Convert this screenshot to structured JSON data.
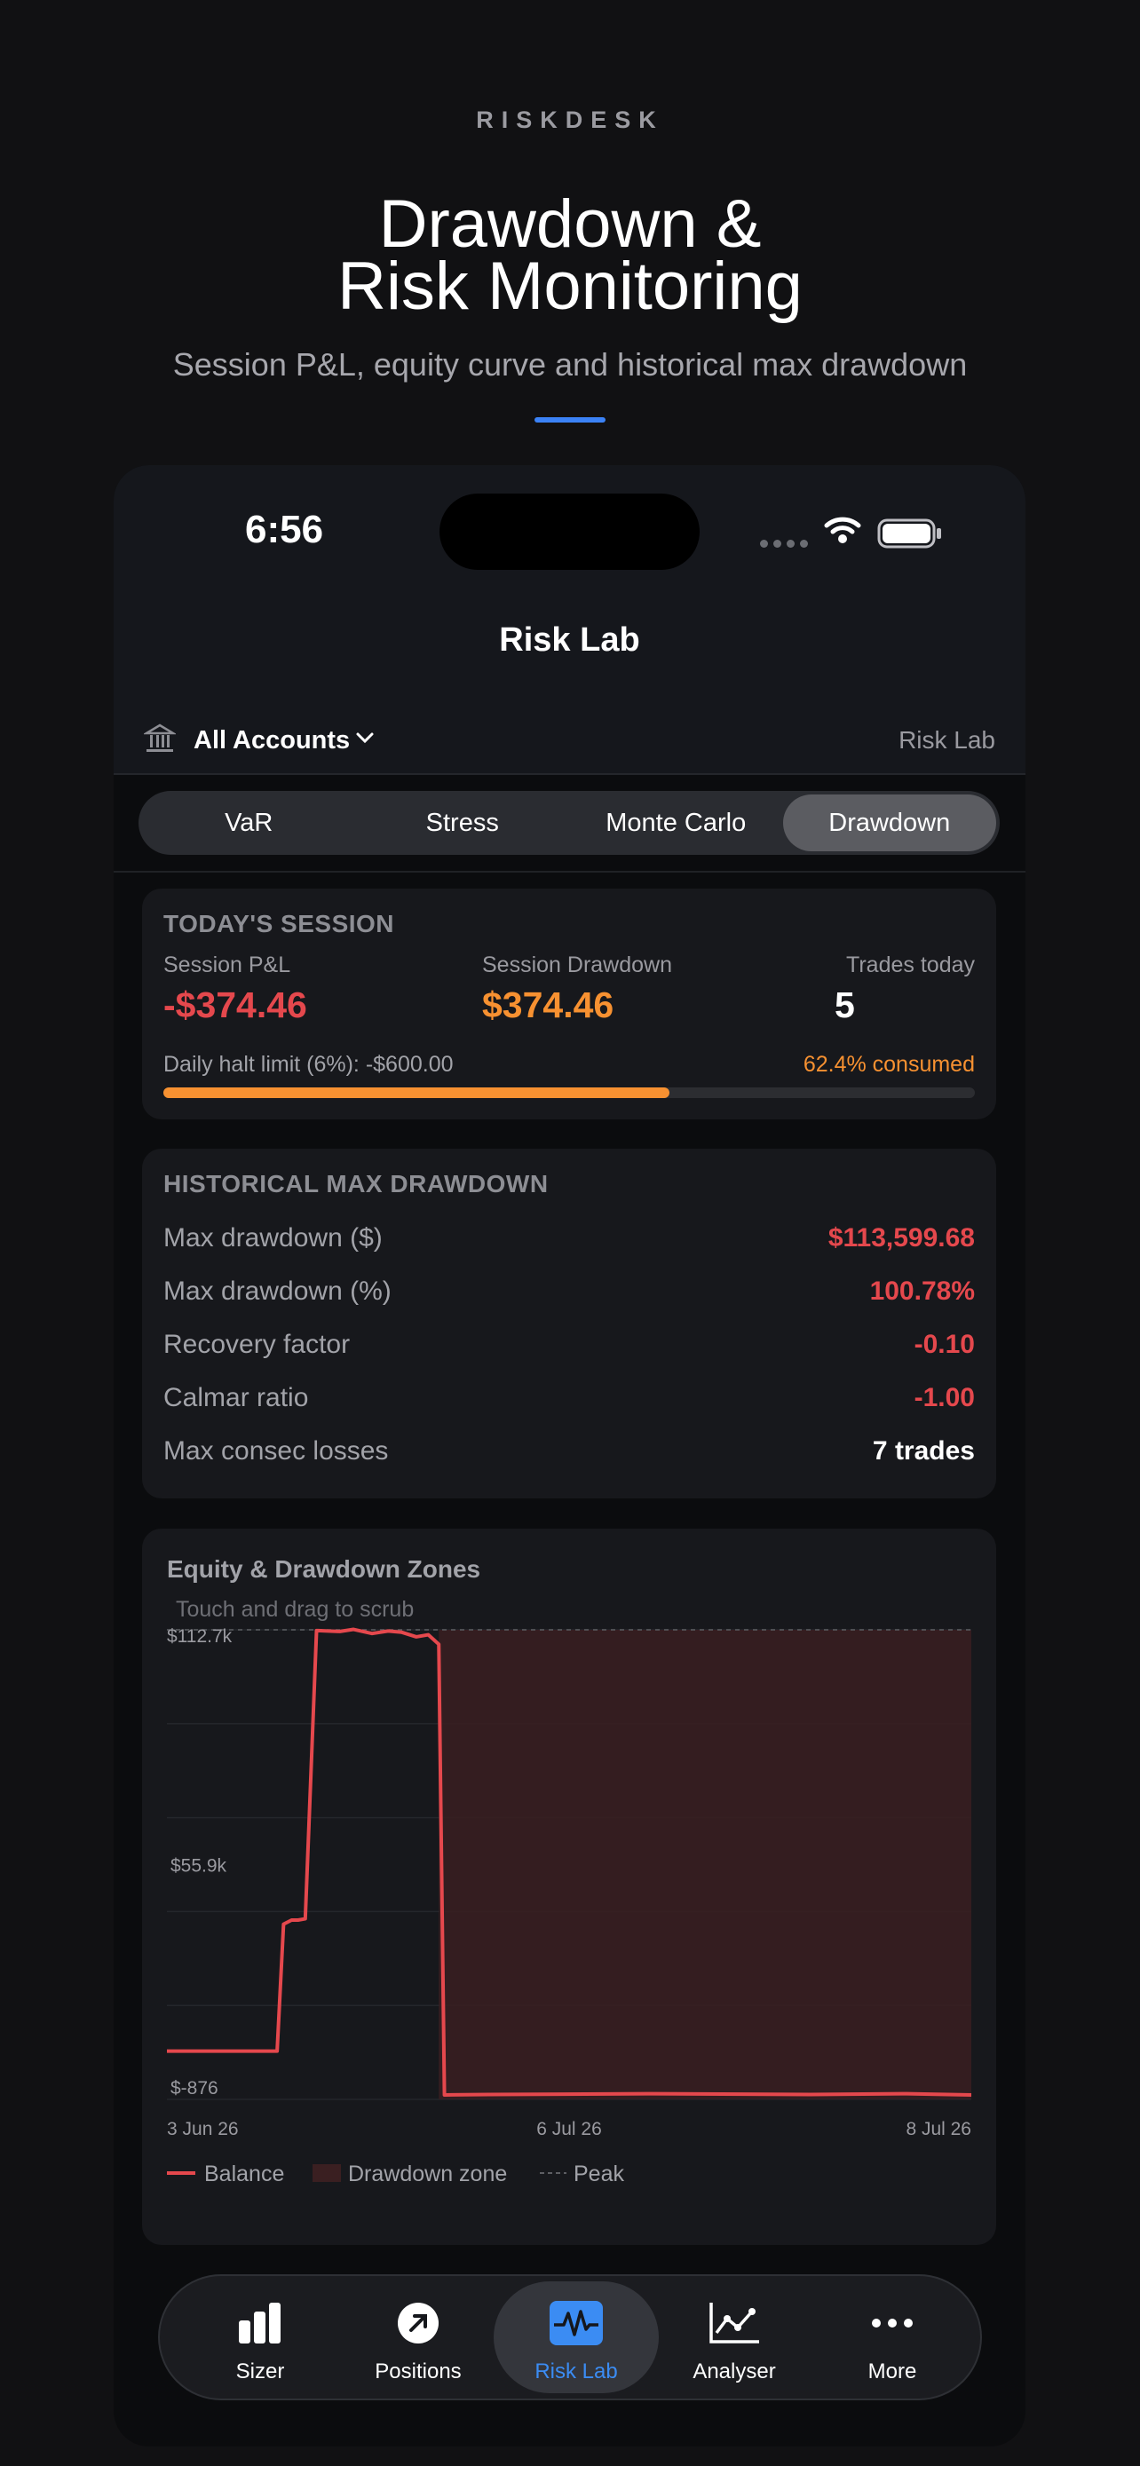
{
  "brand": "RISKDESK",
  "hero": {
    "title_line1": "Drawdown &",
    "title_line2": "Risk Monitoring",
    "subtitle": "Session P&L, equity curve and historical max drawdown"
  },
  "status_bar": {
    "time": "6:56"
  },
  "nav": {
    "title": "Risk Lab"
  },
  "account": {
    "selector": "All Accounts",
    "right_label": "Risk Lab"
  },
  "segments": [
    "VaR",
    "Stress",
    "Monte Carlo",
    "Drawdown"
  ],
  "active_segment": "Drawdown",
  "session": {
    "header": "TODAY'S SESSION",
    "pnl_label": "Session P&L",
    "pnl_value": "-$374.46",
    "drawdown_label": "Session Drawdown",
    "drawdown_value": "$374.46",
    "trades_label": "Trades today",
    "trades_value": "5",
    "halt_label": "Daily halt limit (6%): -$600.00",
    "consumed_label": "62.4% consumed",
    "consumed_fraction": 0.624
  },
  "historical": {
    "header": "HISTORICAL MAX DRAWDOWN",
    "rows": [
      {
        "label": "Max drawdown ($)",
        "value": "$113,599.68",
        "tone": "red"
      },
      {
        "label": "Max drawdown (%)",
        "value": "100.78%",
        "tone": "red"
      },
      {
        "label": "Recovery factor",
        "value": "-0.10",
        "tone": "red"
      },
      {
        "label": "Calmar ratio",
        "value": "-1.00",
        "tone": "red"
      },
      {
        "label": "Max consec losses",
        "value": "7 trades",
        "tone": "white"
      }
    ]
  },
  "chart_section": {
    "title": "Equity & Drawdown Zones",
    "hint": "Touch and drag to scrub"
  },
  "chart_data": {
    "type": "line",
    "title": "Equity & Drawdown Zones",
    "y_tick_labels": [
      "$112.7k",
      "$55.9k",
      "$-876"
    ],
    "x_tick_labels": [
      "3 Jun 26",
      "6 Jul 26",
      "8 Jul 26"
    ],
    "ylim": [
      -876,
      112700
    ],
    "grid": true,
    "legend": [
      "Balance",
      "Drawdown zone",
      "Peak"
    ],
    "legend_position": "bottom-left",
    "series": [
      {
        "name": "Balance",
        "color": "#e5484d",
        "x_fraction": [
          0,
          0.137,
          0.142,
          0.145,
          0.155,
          0.163,
          0.172,
          0.186,
          0.188,
          0.2,
          0.215,
          0.232,
          0.255,
          0.275,
          0.292,
          0.31,
          0.325,
          0.338,
          0.345,
          0.4,
          0.6,
          0.8,
          0.92,
          1.0
        ],
        "values": [
          10800,
          10800,
          30000,
          41500,
          42500,
          42500,
          42800,
          112500,
          112500,
          112400,
          112300,
          112800,
          111800,
          112400,
          112100,
          111000,
          111500,
          109200,
          200,
          300,
          500,
          300,
          500,
          200
        ]
      }
    ],
    "peak_value": 112700,
    "drawdown_zone_start_fraction": 0.338
  },
  "tabbar": {
    "items": [
      {
        "label": "Sizer",
        "icon": "bar-chart-icon"
      },
      {
        "label": "Positions",
        "icon": "arrow-up-right-icon"
      },
      {
        "label": "Risk Lab",
        "icon": "pulse-icon"
      },
      {
        "label": "Analyser",
        "icon": "line-chart-icon"
      },
      {
        "label": "More",
        "icon": "more-icon"
      }
    ],
    "active": "Risk Lab"
  },
  "colors": {
    "red": "#e5484d",
    "orange": "#f79131",
    "blue": "#3b82f6",
    "active_tab": "#3b8cf3"
  }
}
